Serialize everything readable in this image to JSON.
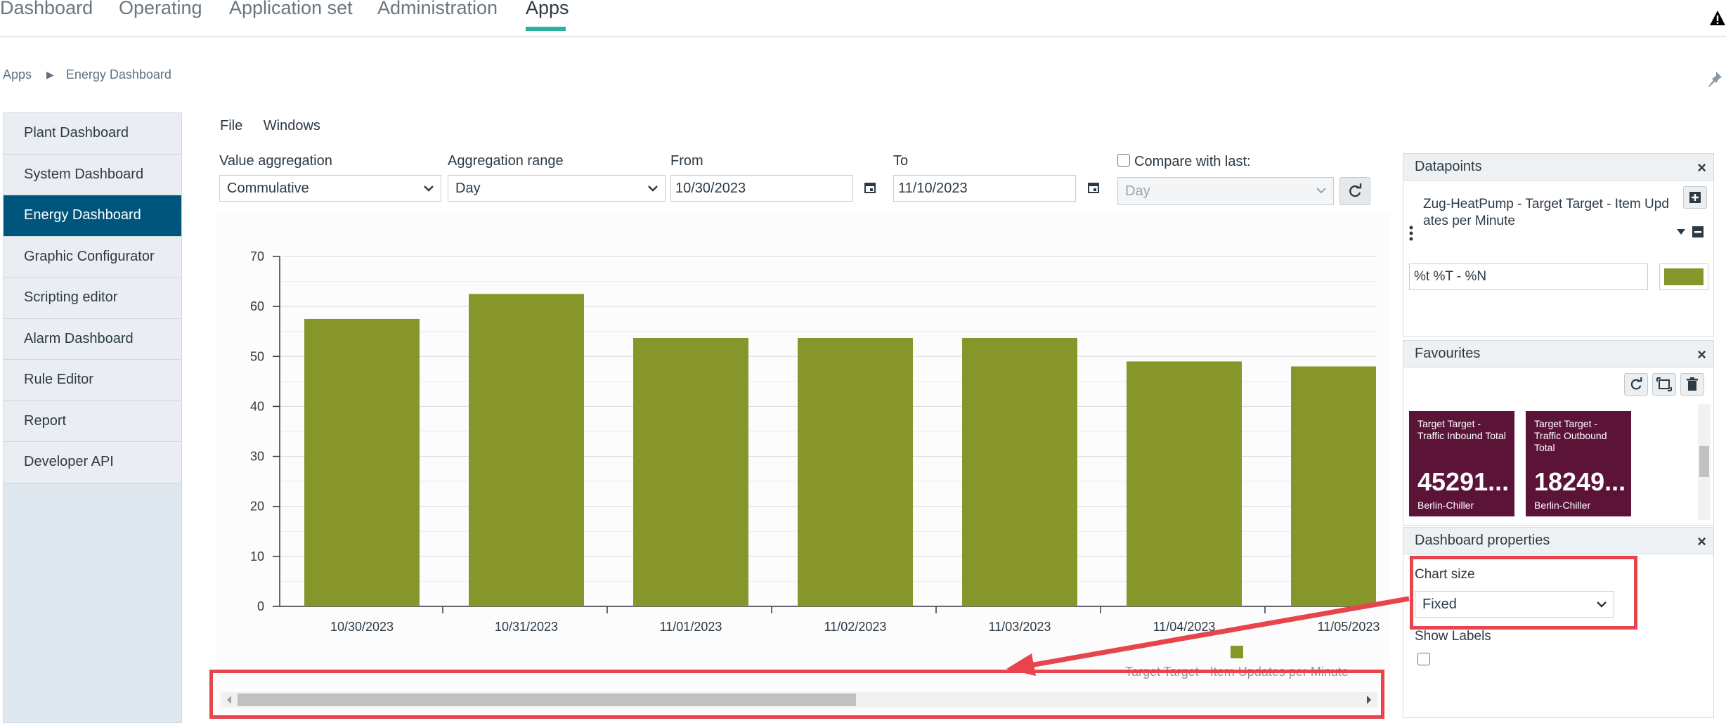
{
  "topnav": {
    "tabs": [
      "Dashboard",
      "Operating",
      "Application set",
      "Administration",
      "Apps"
    ],
    "active": "Apps"
  },
  "breadcrumb": {
    "root": "Apps",
    "separator": "▶",
    "current": "Energy Dashboard"
  },
  "sidebar": {
    "items": [
      {
        "label": "Plant Dashboard"
      },
      {
        "label": "System Dashboard"
      },
      {
        "label": "Energy Dashboard"
      },
      {
        "label": "Graphic Configurator"
      },
      {
        "label": "Scripting editor"
      },
      {
        "label": "Alarm Dashboard"
      },
      {
        "label": "Rule Editor"
      },
      {
        "label": "Report"
      },
      {
        "label": "Developer API"
      }
    ],
    "active_index": 2
  },
  "menubar": {
    "file": "File",
    "windows": "Windows"
  },
  "controls": {
    "value_aggregation": {
      "label": "Value aggregation",
      "value": "Commulative"
    },
    "aggregation_range": {
      "label": "Aggregation range",
      "value": "Day"
    },
    "from": {
      "label": "From",
      "value": "10/30/2023"
    },
    "to": {
      "label": "To",
      "value": "11/10/2023"
    },
    "compare": {
      "label": "Compare with last:",
      "value": "Day",
      "checked": false
    }
  },
  "chart_data": {
    "type": "bar",
    "categories": [
      "10/30/2023",
      "10/31/2023",
      "11/01/2023",
      "11/02/2023",
      "11/03/2023",
      "11/04/2023",
      "11/05/2023"
    ],
    "series": [
      {
        "name": "Target Target - Item Updates per Minute",
        "values": [
          57.5,
          62.5,
          53.7,
          53.7,
          53.7,
          49.0,
          48.0
        ],
        "color": "#86962b"
      }
    ],
    "yticks": [
      0,
      10,
      20,
      30,
      40,
      50,
      60,
      70
    ],
    "ylim": [
      0,
      70
    ],
    "grid": true,
    "legend": "bottom-right"
  },
  "scrollbar": {
    "position_fraction": 0.0,
    "visible_fraction": 0.55
  },
  "datapoints": {
    "title": "Datapoints",
    "item": "Zug-HeatPump - Target Target - Item Upd ates per Minute",
    "format": "%t %T - %N",
    "color": "#86962b"
  },
  "favourites": {
    "title": "Favourites",
    "tiles": [
      {
        "title": "Target Target - Traffic Inbound Total",
        "value": "45291...",
        "source": "Berlin-Chiller"
      },
      {
        "title": "Target Target - Traffic Outbound Total",
        "value": "18249...",
        "source": "Berlin-Chiller"
      }
    ]
  },
  "dashboard_properties": {
    "title": "Dashboard properties",
    "chart_size_label": "Chart size",
    "chart_size_value": "Fixed",
    "show_labels_label": "Show Labels",
    "show_labels_checked": false
  },
  "colors": {
    "accent": "#2bb0a4",
    "sidebar_active": "#00557d",
    "bar": "#86962b",
    "tile": "#5c1338",
    "annotation": "#e8444d"
  }
}
